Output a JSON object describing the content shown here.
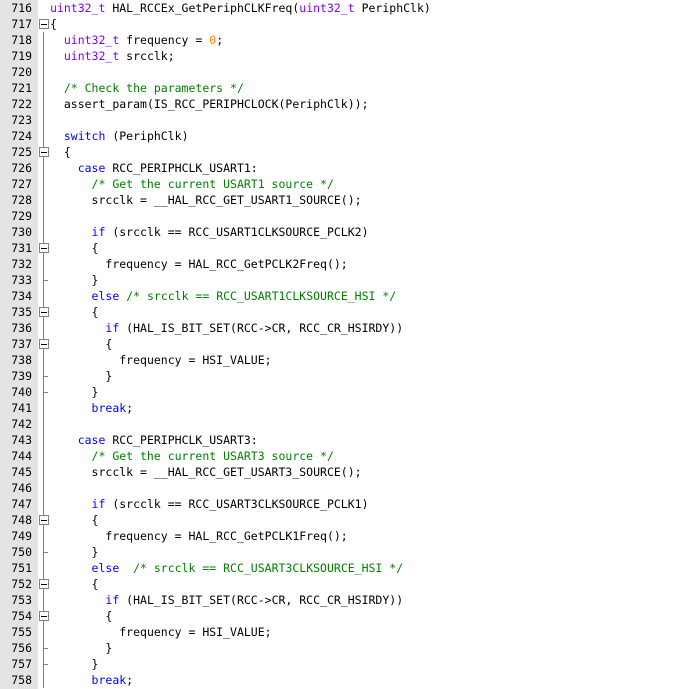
{
  "colors": {
    "type": "#8000ff",
    "keyword": "#0000ff",
    "number": "#ff8000",
    "comment": "#008000",
    "text": "#000000",
    "gutter_bg": "#e4e4e4"
  },
  "lines": [
    {
      "n": "716",
      "fold": "none",
      "indent": "",
      "tokens": [
        [
          "type",
          "uint32_t"
        ],
        [
          "txt",
          " HAL_RCCEx_GetPeriphCLKFreq("
        ],
        [
          "type",
          "uint32_t"
        ],
        [
          "txt",
          " PeriphClk)"
        ]
      ]
    },
    {
      "n": "717",
      "fold": "open",
      "indent": "",
      "tokens": [
        [
          "txt",
          "{"
        ]
      ]
    },
    {
      "n": "718",
      "fold": "line",
      "indent": "  ",
      "tokens": [
        [
          "type",
          "uint32_t"
        ],
        [
          "txt",
          " frequency = "
        ],
        [
          "num",
          "0"
        ],
        [
          "txt",
          ";"
        ]
      ]
    },
    {
      "n": "719",
      "fold": "line",
      "indent": "  ",
      "tokens": [
        [
          "type",
          "uint32_t"
        ],
        [
          "txt",
          " srcclk;"
        ]
      ]
    },
    {
      "n": "720",
      "fold": "line",
      "indent": "",
      "tokens": []
    },
    {
      "n": "721",
      "fold": "line",
      "indent": "  ",
      "tokens": [
        [
          "cmt",
          "/* Check the parameters */"
        ]
      ]
    },
    {
      "n": "722",
      "fold": "line",
      "indent": "  ",
      "tokens": [
        [
          "txt",
          "assert_param(IS_RCC_PERIPHCLOCK(PeriphClk));"
        ]
      ]
    },
    {
      "n": "723",
      "fold": "line",
      "indent": "",
      "tokens": []
    },
    {
      "n": "724",
      "fold": "line",
      "indent": "  ",
      "tokens": [
        [
          "kw",
          "switch"
        ],
        [
          "txt",
          " (PeriphClk)"
        ]
      ]
    },
    {
      "n": "725",
      "fold": "open",
      "indent": "  ",
      "tokens": [
        [
          "txt",
          "{"
        ]
      ]
    },
    {
      "n": "726",
      "fold": "line",
      "indent": "    ",
      "tokens": [
        [
          "kw",
          "case"
        ],
        [
          "txt",
          " RCC_PERIPHCLK_USART1:"
        ]
      ]
    },
    {
      "n": "727",
      "fold": "line",
      "indent": "      ",
      "tokens": [
        [
          "cmt",
          "/* Get the current USART1 source */"
        ]
      ]
    },
    {
      "n": "728",
      "fold": "line",
      "indent": "      ",
      "tokens": [
        [
          "txt",
          "srcclk = __HAL_RCC_GET_USART1_SOURCE();"
        ]
      ]
    },
    {
      "n": "729",
      "fold": "line",
      "indent": "",
      "tokens": []
    },
    {
      "n": "730",
      "fold": "line",
      "indent": "      ",
      "tokens": [
        [
          "kw",
          "if"
        ],
        [
          "txt",
          " (srcclk == RCC_USART1CLKSOURCE_PCLK2)"
        ]
      ]
    },
    {
      "n": "731",
      "fold": "open",
      "indent": "      ",
      "tokens": [
        [
          "txt",
          "{"
        ]
      ]
    },
    {
      "n": "732",
      "fold": "line",
      "indent": "        ",
      "tokens": [
        [
          "txt",
          "frequency = HAL_RCC_GetPCLK2Freq();"
        ]
      ]
    },
    {
      "n": "733",
      "fold": "end",
      "indent": "      ",
      "tokens": [
        [
          "txt",
          "}"
        ]
      ]
    },
    {
      "n": "734",
      "fold": "line",
      "indent": "      ",
      "tokens": [
        [
          "kw",
          "else"
        ],
        [
          "txt",
          " "
        ],
        [
          "cmt",
          "/* srcclk == RCC_USART1CLKSOURCE_HSI */"
        ]
      ]
    },
    {
      "n": "735",
      "fold": "open",
      "indent": "      ",
      "tokens": [
        [
          "txt",
          "{"
        ]
      ]
    },
    {
      "n": "736",
      "fold": "line",
      "indent": "        ",
      "tokens": [
        [
          "kw",
          "if"
        ],
        [
          "txt",
          " (HAL_IS_BIT_SET(RCC->CR, RCC_CR_HSIRDY))"
        ]
      ]
    },
    {
      "n": "737",
      "fold": "open",
      "indent": "        ",
      "tokens": [
        [
          "txt",
          "{"
        ]
      ]
    },
    {
      "n": "738",
      "fold": "line",
      "indent": "          ",
      "tokens": [
        [
          "txt",
          "frequency = HSI_VALUE;"
        ]
      ]
    },
    {
      "n": "739",
      "fold": "end",
      "indent": "        ",
      "tokens": [
        [
          "txt",
          "}"
        ]
      ]
    },
    {
      "n": "740",
      "fold": "end",
      "indent": "      ",
      "tokens": [
        [
          "txt",
          "}"
        ]
      ]
    },
    {
      "n": "741",
      "fold": "line",
      "indent": "      ",
      "tokens": [
        [
          "kw",
          "break"
        ],
        [
          "txt",
          ";"
        ]
      ]
    },
    {
      "n": "742",
      "fold": "line",
      "indent": "",
      "tokens": []
    },
    {
      "n": "743",
      "fold": "line",
      "indent": "    ",
      "tokens": [
        [
          "kw",
          "case"
        ],
        [
          "txt",
          " RCC_PERIPHCLK_USART3:"
        ]
      ]
    },
    {
      "n": "744",
      "fold": "line",
      "indent": "      ",
      "tokens": [
        [
          "cmt",
          "/* Get the current USART3 source */"
        ]
      ]
    },
    {
      "n": "745",
      "fold": "line",
      "indent": "      ",
      "tokens": [
        [
          "txt",
          "srcclk = __HAL_RCC_GET_USART3_SOURCE();"
        ]
      ]
    },
    {
      "n": "746",
      "fold": "line",
      "indent": "",
      "tokens": []
    },
    {
      "n": "747",
      "fold": "line",
      "indent": "      ",
      "tokens": [
        [
          "kw",
          "if"
        ],
        [
          "txt",
          " (srcclk == RCC_USART3CLKSOURCE_PCLK1)"
        ]
      ]
    },
    {
      "n": "748",
      "fold": "open",
      "indent": "      ",
      "tokens": [
        [
          "txt",
          "{"
        ]
      ]
    },
    {
      "n": "749",
      "fold": "line",
      "indent": "        ",
      "tokens": [
        [
          "txt",
          "frequency = HAL_RCC_GetPCLK1Freq();"
        ]
      ]
    },
    {
      "n": "750",
      "fold": "end",
      "indent": "      ",
      "tokens": [
        [
          "txt",
          "}"
        ]
      ]
    },
    {
      "n": "751",
      "fold": "line",
      "indent": "      ",
      "tokens": [
        [
          "kw",
          "else"
        ],
        [
          "txt",
          "  "
        ],
        [
          "cmt",
          "/* srcclk == RCC_USART3CLKSOURCE_HSI */"
        ]
      ]
    },
    {
      "n": "752",
      "fold": "open",
      "indent": "      ",
      "tokens": [
        [
          "txt",
          "{"
        ]
      ]
    },
    {
      "n": "753",
      "fold": "line",
      "indent": "        ",
      "tokens": [
        [
          "kw",
          "if"
        ],
        [
          "txt",
          " (HAL_IS_BIT_SET(RCC->CR, RCC_CR_HSIRDY))"
        ]
      ]
    },
    {
      "n": "754",
      "fold": "open",
      "indent": "        ",
      "tokens": [
        [
          "txt",
          "{"
        ]
      ]
    },
    {
      "n": "755",
      "fold": "line",
      "indent": "          ",
      "tokens": [
        [
          "txt",
          "frequency = HSI_VALUE;"
        ]
      ]
    },
    {
      "n": "756",
      "fold": "end",
      "indent": "        ",
      "tokens": [
        [
          "txt",
          "}"
        ]
      ]
    },
    {
      "n": "757",
      "fold": "end",
      "indent": "      ",
      "tokens": [
        [
          "txt",
          "}"
        ]
      ]
    },
    {
      "n": "758",
      "fold": "line",
      "indent": "      ",
      "tokens": [
        [
          "kw",
          "break"
        ],
        [
          "txt",
          ";"
        ]
      ]
    }
  ]
}
